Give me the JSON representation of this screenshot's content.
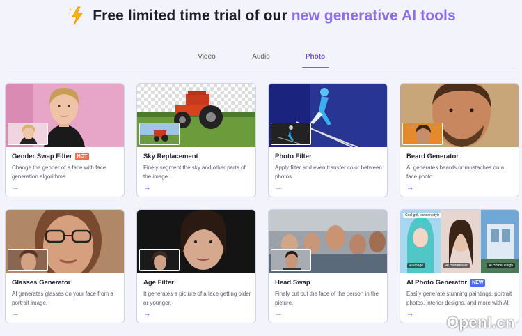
{
  "header": {
    "title_main": "Free limited time trial of our ",
    "title_accent": "new generative AI tools",
    "icon": "lightning-bolt-icon",
    "accent_color": "#8b6cf6"
  },
  "tabs": [
    {
      "label": "Video",
      "active": false
    },
    {
      "label": "Audio",
      "active": false
    },
    {
      "label": "Photo",
      "active": true
    }
  ],
  "cards": [
    {
      "title": "Gender Swap Filter",
      "badge": "HOT",
      "desc": "Change the gender of a face with face generation algorithms."
    },
    {
      "title": "Sky Replacement",
      "badge": "",
      "desc": "Finely segment the sky and other parts of the image."
    },
    {
      "title": "Photo Filter",
      "badge": "",
      "desc": "Apply filter and even transfer color between photos."
    },
    {
      "title": "Beard Generator",
      "badge": "",
      "desc": "AI generates beards or mustaches on a face photo."
    },
    {
      "title": "Glasses Generator",
      "badge": "",
      "desc": "AI generates glasses on your face from a portrait image."
    },
    {
      "title": "Age Filter",
      "badge": "",
      "desc": "It generates a picture of a face getting older or younger."
    },
    {
      "title": "Head Swap",
      "badge": "",
      "desc": "Finely cut out the face of the person in the picture."
    },
    {
      "title": "AI Photo Generator",
      "badge": "NEW",
      "desc": "Easily generate stunning paintings, portrait photos, interior designs, and more with AI."
    }
  ],
  "card4_labels": [
    "Cool girl, cartoon style",
    "AI Image",
    "AI Hairdresser",
    "AI HomeDesign"
  ],
  "arrow_glyph": "→",
  "watermark": "OpenI.cn"
}
